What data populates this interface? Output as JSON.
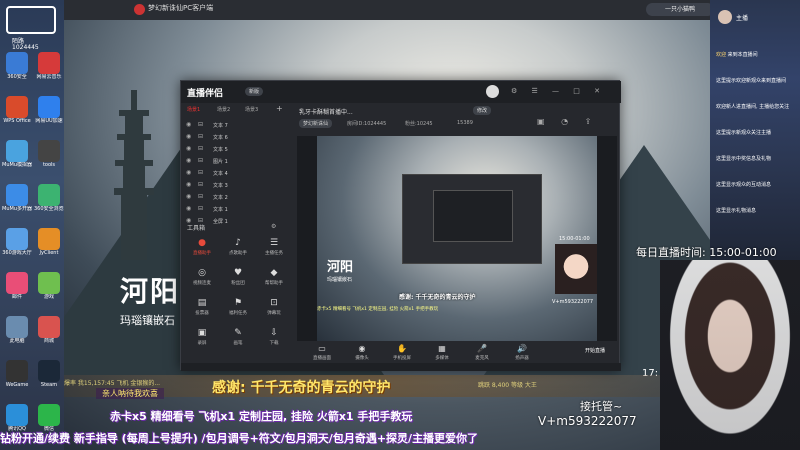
{
  "outer_window": {
    "title": "梦幻新诛仙PC客户端",
    "user_label": "一只小猫鸭"
  },
  "desktop": {
    "corner_label_1": "陌路",
    "corner_label_2": "1024445",
    "icons": [
      {
        "name": "360-icon",
        "label": "360安全"
      },
      {
        "name": "netease-icon",
        "label": "网易云音乐"
      },
      {
        "name": "wps-icon",
        "label": "WPS Office"
      },
      {
        "name": "netease-uu-icon",
        "label": "网易UU加速"
      },
      {
        "name": "mumu-icon",
        "label": "MuMu模拟器"
      },
      {
        "name": "tools-icon",
        "label": "tools"
      },
      {
        "name": "mumu-multi-icon",
        "label": "MuMu多开器"
      },
      {
        "name": "360-browser-icon",
        "label": "360安全浏览器"
      },
      {
        "name": "360-game-icon",
        "label": "360游戏大厅"
      },
      {
        "name": "jy-icon",
        "label": "JyClient"
      },
      {
        "name": "mail-icon",
        "label": "邮件"
      },
      {
        "name": "game-icon",
        "label": "游戏"
      },
      {
        "name": "pc-icon",
        "label": "此电脑"
      },
      {
        "name": "shop-icon",
        "label": "商城"
      },
      {
        "name": "wegame-icon",
        "label": "WeGame"
      },
      {
        "name": "steam-icon",
        "label": "Steam"
      },
      {
        "name": "qq-icon",
        "label": "腾讯QQ"
      },
      {
        "name": "wechat-icon",
        "label": "微信"
      }
    ]
  },
  "scene": {
    "title": "河阳",
    "subtitle": "玛瑙镶嵌石"
  },
  "stream_app": {
    "logo": "直播伴侣",
    "logo_badge": "新版",
    "tabs": [
      "场景1",
      "场景2",
      "场景3"
    ],
    "sources": [
      "文本 7",
      "文本 6",
      "文本 5",
      "图片 1",
      "文本 4",
      "文本 3",
      "文本 2",
      "文本 1",
      "全屏 1"
    ],
    "tools_title": "工具箱",
    "tools": [
      {
        "icon": "●",
        "label": "直播助手",
        "red": true
      },
      {
        "icon": "♪",
        "label": "点歌助手",
        "red": false
      },
      {
        "icon": "☰",
        "label": "主播任务",
        "red": false
      },
      {
        "icon": "◎",
        "label": "视频连麦",
        "red": false
      },
      {
        "icon": "♥",
        "label": "粉丝团",
        "red": false
      },
      {
        "icon": "◆",
        "label": "帮帮助手",
        "red": false
      },
      {
        "icon": "▤",
        "label": "投票器",
        "red": false
      },
      {
        "icon": "⚑",
        "label": "福利任务",
        "red": false
      },
      {
        "icon": "⊡",
        "label": "弹幕玩",
        "red": false
      },
      {
        "icon": "▣",
        "label": "录屏",
        "red": false
      },
      {
        "icon": "✎",
        "label": "画笔",
        "red": false
      },
      {
        "icon": "⇩",
        "label": "下载",
        "red": false
      }
    ],
    "room_title": "乳牙卡酥糊首播中...",
    "room_tag": "修改",
    "room_category": "梦幻新诛仙",
    "room_id": "房间ID:1024445",
    "room_fans": "粉丝:10245",
    "room_likes": "15389",
    "preview": {
      "title": "河阳",
      "subtitle": "玛瑙镶嵌石",
      "time": "15:00-01:00",
      "thanks": "感谢: 千千无奇的青云的守护",
      "chat": "赤卡x5 精细看号 飞机x1 定制庄园, 挂险 火箭x1 手把手教玩",
      "vx": "V+m593222077"
    },
    "bottom_tools": [
      {
        "icon": "▭",
        "label": "直播画面"
      },
      {
        "icon": "◉",
        "label": "摄像头"
      },
      {
        "icon": "✋",
        "label": "手机投屏"
      },
      {
        "icon": "▦",
        "label": "多媒体"
      },
      {
        "icon": "🎤",
        "label": "麦克风"
      },
      {
        "icon": "🔊",
        "label": "扬声器"
      }
    ],
    "live_status": "开始直播"
  },
  "right_panel": {
    "header": "主播",
    "messages": [
      {
        "name": "欢迎",
        "text": "来到本直播间"
      },
      {
        "name": "",
        "text": "这里提示欢迎新观众来到直播间"
      },
      {
        "name": "",
        "text": "欢迎新人进直播间, 主播给您关注"
      },
      {
        "name": "",
        "text": "这里提示新观众关注主播"
      },
      {
        "name": "",
        "text": "这里显示中奖信息及礼物"
      },
      {
        "name": "",
        "text": "这里显示观众的互动消息"
      },
      {
        "name": "",
        "text": "这里显示礼物消息"
      }
    ]
  },
  "overlays": {
    "schedule": "每日直播时间: 15:00-01:00",
    "thanks": "感谢: 千千无奇的青云的守护",
    "welcome": "亲人呐待我欢喜",
    "gift_line": "赤卡x5 精细看号  飞机x1 定制庄园, 挂险  火箭x1 手把手教玩",
    "command_line": "钻粉开通/续费 新手指导 (每周上号提升) /包月调号+符文/包月洞天/包月奇遇+探灵/主播更爱你了",
    "handover": "接托管~",
    "vx": "V+m593222077",
    "clock": "17:",
    "scroll_left": "爆率 我15,157:45 飞机 金银猴的...",
    "scroll_right": "跳跃 8,400 等级 大王"
  },
  "colors": {
    "accent_red": "#e64a3b",
    "gold_text": "#ffe66a",
    "purple_outline": "#6b2aa8"
  }
}
